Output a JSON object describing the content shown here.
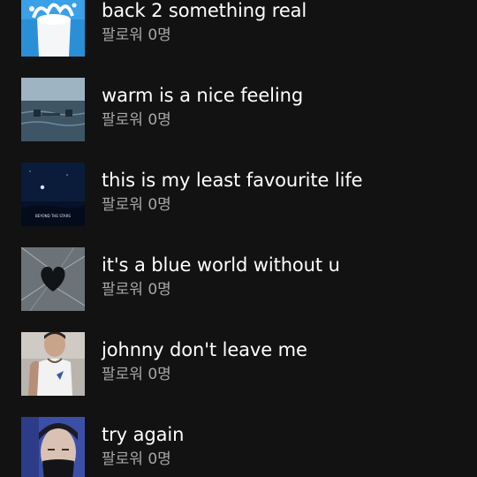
{
  "playlists": [
    {
      "title": "back 2 something real",
      "followers": "팔로워 0명",
      "cover": "milk-splash-cover"
    },
    {
      "title": "warm is a nice feeling",
      "followers": "팔로워 0명",
      "cover": "sea-table-cover"
    },
    {
      "title": "this is my least favourite life",
      "followers": "팔로워 0명",
      "cover": "beyond-the-stars-cover",
      "cover_caption": "BEYOND THE STARS"
    },
    {
      "title": "it's a blue world without u",
      "followers": "팔로워 0명",
      "cover": "broken-heart-glass-cover"
    },
    {
      "title": "johnny don't leave me",
      "followers": "팔로워 0명",
      "cover": "person-tanktop-cover"
    },
    {
      "title": "try again",
      "followers": "팔로워 0명",
      "cover": "masked-person-cover"
    }
  ],
  "colors": {
    "background": "#121212",
    "title": "#ffffff",
    "subtitle": "#a7a7a7"
  }
}
